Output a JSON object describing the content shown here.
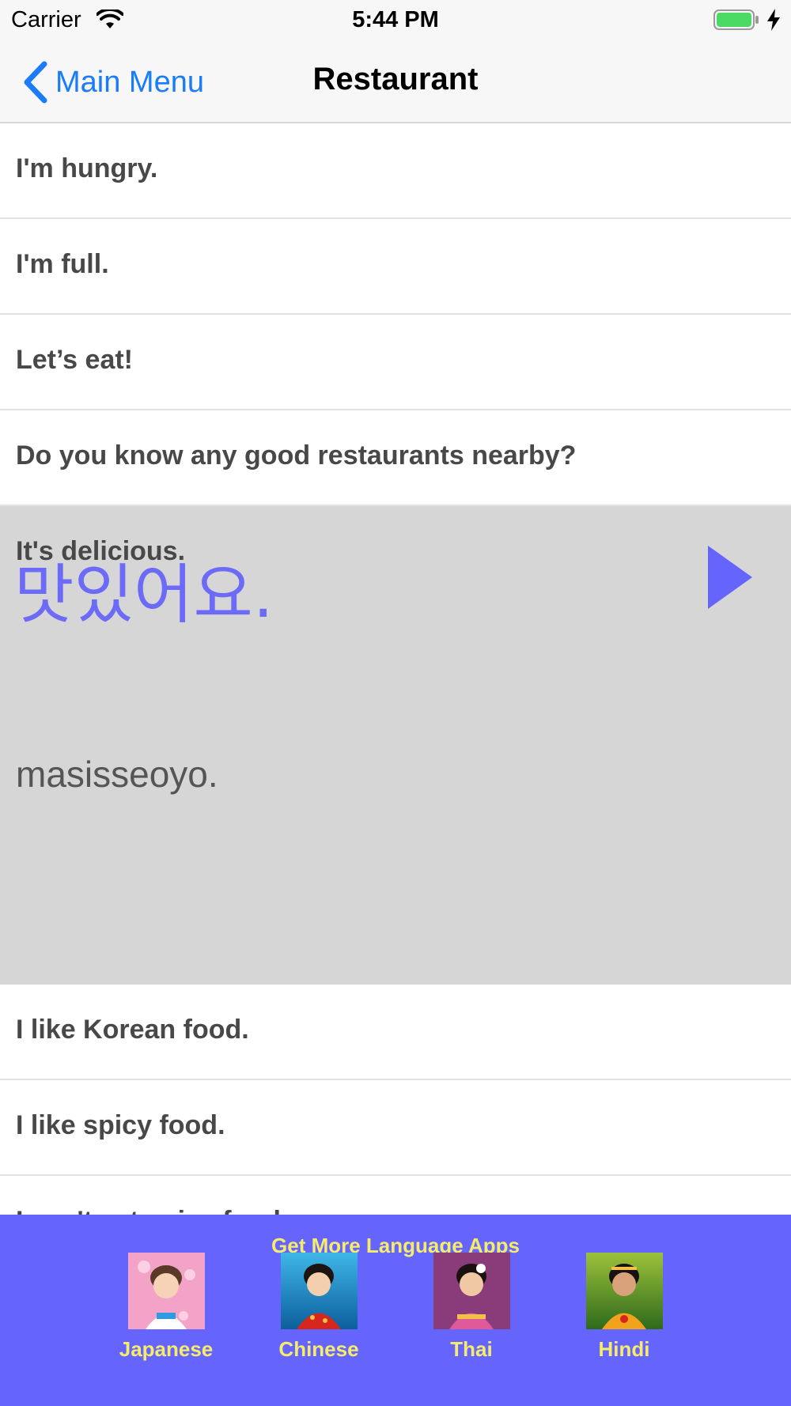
{
  "status_bar": {
    "carrier": "Carrier",
    "time": "5:44 PM",
    "battery_color": "#4cd964",
    "icons": [
      "wifi-icon",
      "battery-icon",
      "bolt-icon"
    ]
  },
  "nav": {
    "back_label": "Main Menu",
    "title": "Restaurant",
    "accent_color": "#1a7cf6"
  },
  "phrases": [
    {
      "label": "I'm hungry."
    },
    {
      "label": "I'm full."
    },
    {
      "label": "Let’s eat!"
    },
    {
      "label": "Do you know any good restaurants nearby?"
    },
    {
      "label": "It's delicious.",
      "expanded": true,
      "korean": "맛있어요.",
      "romanized": "masisseoyo."
    },
    {
      "label": "I like Korean food."
    },
    {
      "label": "I like spicy food."
    },
    {
      "label": "I can't eat spicy food."
    }
  ],
  "expanded_colors": {
    "background": "#d6d6d6",
    "korean": "#6b6bf7",
    "play_icon": "#6565fd"
  },
  "promo": {
    "title": "Get More Language Apps",
    "background": "#6565fd",
    "text_color": "#f5ec6b",
    "apps": [
      {
        "label": "Japanese"
      },
      {
        "label": "Chinese"
      },
      {
        "label": "Thai"
      },
      {
        "label": "Hindi"
      }
    ]
  }
}
